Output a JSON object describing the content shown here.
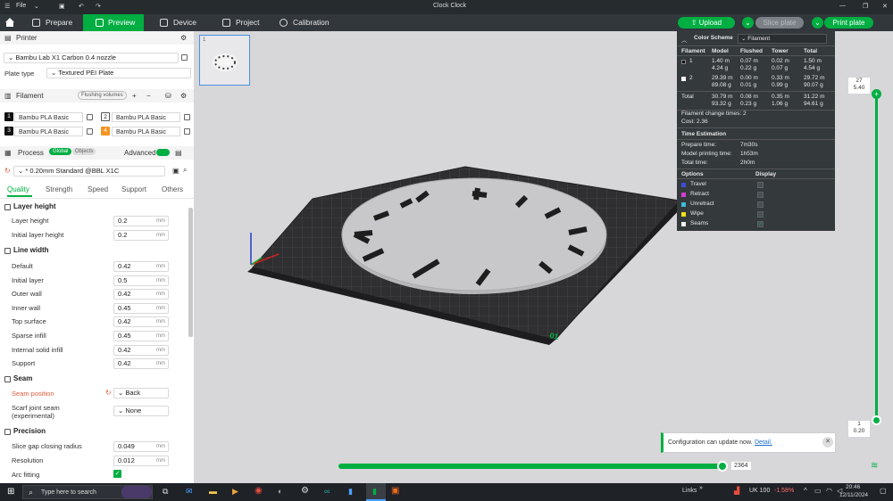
{
  "titlebar": {
    "menu": "File",
    "title": "Clock Clock"
  },
  "toolbar": {
    "tabs": [
      {
        "label": "Prepare"
      },
      {
        "label": "Preview"
      },
      {
        "label": "Device"
      },
      {
        "label": "Project"
      },
      {
        "label": "Calibration"
      }
    ],
    "upload": "Upload",
    "slice": "Slice plate",
    "print": "Print plate"
  },
  "printer": {
    "section": "Printer",
    "name": "Bambu Lab X1 Carbon 0.4 nozzle",
    "plate_label": "Plate type",
    "plate_value": "Textured PEI Plate"
  },
  "filament": {
    "section": "Filament",
    "flushing": "Flushing volumes",
    "items": [
      {
        "num": "1",
        "name": "Bambu PLA Basic",
        "color": "#111111"
      },
      {
        "num": "2",
        "name": "Bambu PLA Basic",
        "color": "#ffffff"
      },
      {
        "num": "3",
        "name": "Bambu PLA Basic",
        "color": "#111111"
      },
      {
        "num": "4",
        "name": "Bambu PLA Basic",
        "color": "#f39423"
      }
    ]
  },
  "process": {
    "section": "Process",
    "global": "Global",
    "objects": "Objects",
    "advanced": "Advanced",
    "preset": "* 0.20mm Standard @BBL X1C",
    "tabs": [
      "Quality",
      "Strength",
      "Speed",
      "Support",
      "Others"
    ]
  },
  "settings": {
    "layer_height_title": "Layer height",
    "layer_height": {
      "label": "Layer height",
      "value": "0.2",
      "unit": "mm"
    },
    "initial_layer_height": {
      "label": "Initial layer height",
      "value": "0.2",
      "unit": "mm"
    },
    "line_width_title": "Line width",
    "line_width": [
      {
        "label": "Default",
        "value": "0.42"
      },
      {
        "label": "Initial layer",
        "value": "0.5"
      },
      {
        "label": "Outer wall",
        "value": "0.42"
      },
      {
        "label": "Inner wall",
        "value": "0.45"
      },
      {
        "label": "Top surface",
        "value": "0.42"
      },
      {
        "label": "Sparse infill",
        "value": "0.45"
      },
      {
        "label": "Internal solid infill",
        "value": "0.42"
      },
      {
        "label": "Support",
        "value": "0.42"
      }
    ],
    "unit_mm": "mm",
    "seam_title": "Seam",
    "seam_position": {
      "label": "Seam position",
      "value": "Back"
    },
    "scarf": {
      "label1": "Scarf joint seam",
      "label2": "(experimental)",
      "value": "None"
    },
    "precision_title": "Precision",
    "slice_gap": {
      "label": "Slice gap closing radius",
      "value": "0.049"
    },
    "resolution": {
      "label": "Resolution",
      "value": "0.012"
    },
    "arc_fitting": {
      "label": "Arc fitting",
      "checked": true
    }
  },
  "stats": {
    "color_scheme": "Color Scheme",
    "scheme_value": "Filament",
    "headers": [
      "Filament",
      "Model",
      "Flushed",
      "Tower",
      "Total"
    ],
    "rows": [
      {
        "id": "1",
        "model1": "1.40 m",
        "model2": "4.24 g",
        "flushed1": "0.07 m",
        "flushed2": "0.22 g",
        "tower1": "0.02 m",
        "tower2": "0.07 g",
        "total1": "1.50 m",
        "total2": "4.54 g",
        "color": "#111111"
      },
      {
        "id": "2",
        "model1": "29.39 m",
        "model2": "89.08 g",
        "flushed1": "0.00 m",
        "flushed2": "0.01 g",
        "tower1": "0.33 m",
        "tower2": "0.99 g",
        "total1": "29.72 m",
        "total2": "90.07 g",
        "color": "#ffffff"
      }
    ],
    "total": {
      "label": "Total",
      "model1": "30.79 m",
      "model2": "93.32 g",
      "flushed1": "0.08 m",
      "flushed2": "0.23 g",
      "tower1": "0.35 m",
      "tower2": "1.06 g",
      "total1": "31.22 m",
      "total2": "94.61 g"
    },
    "change_times": "Filament change times:  2",
    "cost": "Cost:  2.36",
    "time_title": "Time Estimation",
    "prepare_label": "Prepare time:",
    "prepare_value": "7m30s",
    "model_label": "Model printing time:",
    "model_value": "1h53m",
    "total_label": "Total time:",
    "total_value": "2h0m",
    "options_label": "Options",
    "display_label": "Display",
    "options": [
      {
        "name": "Travel",
        "color": "#3b50d6",
        "checked": false
      },
      {
        "name": "Retract",
        "color": "#d63bd6",
        "checked": false
      },
      {
        "name": "Unretract",
        "color": "#3bbdd6",
        "checked": false
      },
      {
        "name": "Wipe",
        "color": "#f2e11a",
        "checked": false
      },
      {
        "name": "Seams",
        "color": "#f0f0f0",
        "checked": true
      }
    ]
  },
  "slider": {
    "top_layer": "27",
    "top_height": "5.40",
    "bottom_layer": "1",
    "bottom_height": "0.20",
    "move": "2364",
    "progress": 1.0
  },
  "plate_num": "01",
  "notification": {
    "text": "Configuration can update now.",
    "link": "Detail."
  },
  "taskbar": {
    "search": "Type here to search",
    "links": "Links",
    "stock_name": "UK 100",
    "stock_change": "-1.58%",
    "time": "20:46",
    "date": "12/11/2024"
  }
}
